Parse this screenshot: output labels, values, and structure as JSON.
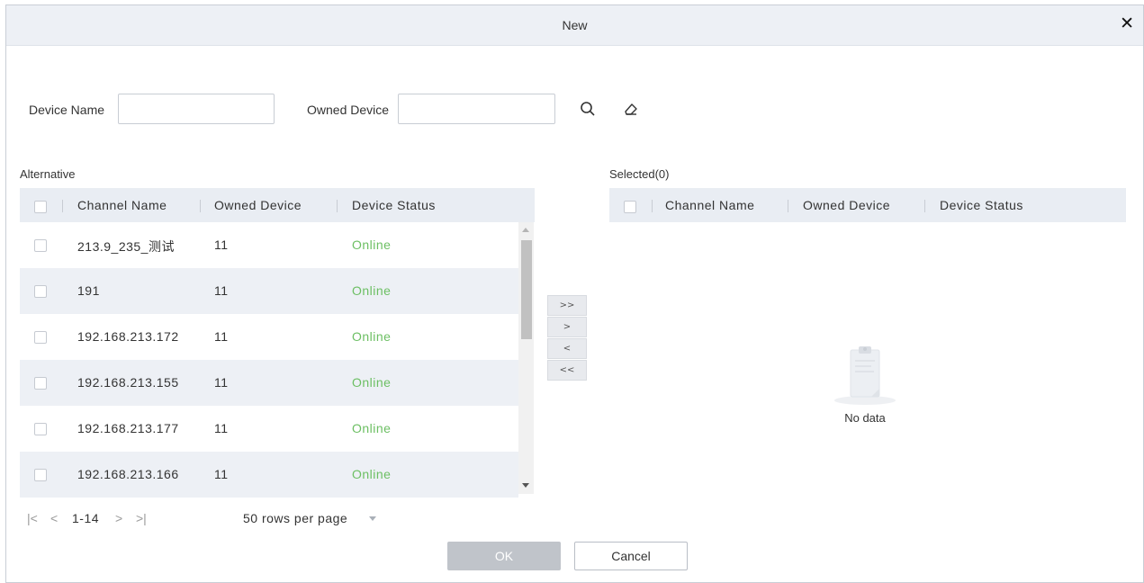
{
  "dialog": {
    "title": "New"
  },
  "search": {
    "device_name_label": "Device Name",
    "device_name_value": "",
    "owned_device_label": "Owned Device",
    "owned_device_value": ""
  },
  "alternative": {
    "title": "Alternative",
    "columns": [
      "Channel Name",
      "Owned Device",
      "Device Status"
    ],
    "rows": [
      {
        "channel": "213.9_235_测试",
        "owned": "11",
        "status": "Online"
      },
      {
        "channel": "191",
        "owned": "11",
        "status": "Online"
      },
      {
        "channel": "192.168.213.172",
        "owned": "11",
        "status": "Online"
      },
      {
        "channel": "192.168.213.155",
        "owned": "11",
        "status": "Online"
      },
      {
        "channel": "192.168.213.177",
        "owned": "11",
        "status": "Online"
      },
      {
        "channel": "192.168.213.166",
        "owned": "11",
        "status": "Online"
      }
    ]
  },
  "pager": {
    "first": "|<",
    "prev": "<",
    "range": "1-14",
    "next": ">",
    "last": ">|",
    "rows_per_page": "50 rows per page"
  },
  "move_buttons": {
    "all_right": ">>",
    "right": ">",
    "left": "<",
    "all_left": "<<"
  },
  "selected": {
    "title": "Selected(0)",
    "columns": [
      "Channel Name",
      "Owned Device",
      "Device Status"
    ],
    "empty_text": "No data"
  },
  "footer": {
    "ok": "OK",
    "cancel": "Cancel"
  },
  "colors": {
    "status_online": "#6cbf63",
    "header_bg": "#e9edf3",
    "row_alt_bg": "#edf0f5",
    "ok_disabled": "#c0c4ca"
  }
}
